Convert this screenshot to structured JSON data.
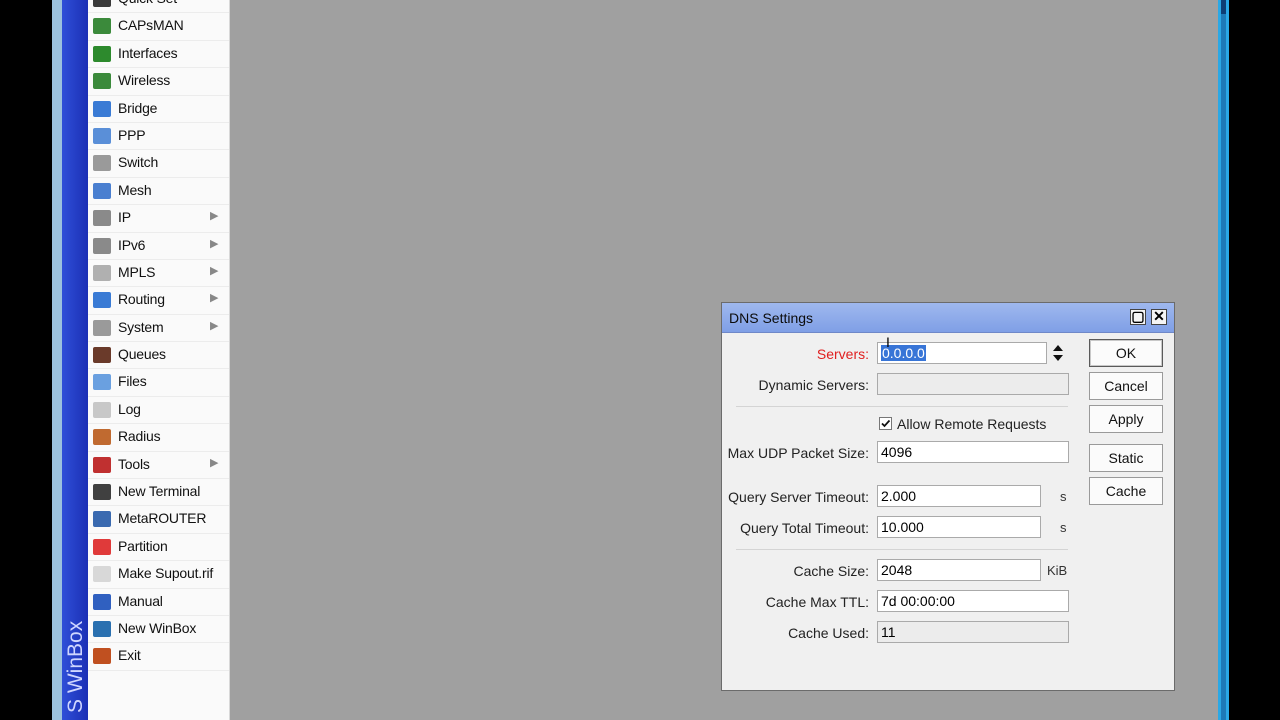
{
  "sidebar": {
    "brand": "S WinBox",
    "items": [
      {
        "label": "Quick Set",
        "icon": "quick-set-icon",
        "color": "#3a3a3a",
        "submenu": false
      },
      {
        "label": "CAPsMAN",
        "icon": "antenna-icon",
        "color": "#3b8a3b",
        "submenu": false
      },
      {
        "label": "Interfaces",
        "icon": "interfaces-icon",
        "color": "#2d8a2d",
        "submenu": false
      },
      {
        "label": "Wireless",
        "icon": "antenna-icon",
        "color": "#3b8a3b",
        "submenu": false
      },
      {
        "label": "Bridge",
        "icon": "bridge-icon",
        "color": "#3a7bd5",
        "submenu": false
      },
      {
        "label": "PPP",
        "icon": "ppp-icon",
        "color": "#5a8fd8",
        "submenu": false
      },
      {
        "label": "Switch",
        "icon": "switch-icon",
        "color": "#9a9a9a",
        "submenu": false
      },
      {
        "label": "Mesh",
        "icon": "mesh-icon",
        "color": "#4a7fd0",
        "submenu": false
      },
      {
        "label": "IP",
        "icon": "ip-icon",
        "color": "#8a8a8a",
        "submenu": true
      },
      {
        "label": "IPv6",
        "icon": "ipv6-icon",
        "color": "#8a8a8a",
        "submenu": true
      },
      {
        "label": "MPLS",
        "icon": "mpls-icon",
        "color": "#b0b0b0",
        "submenu": true
      },
      {
        "label": "Routing",
        "icon": "routing-icon",
        "color": "#3a7bd5",
        "submenu": true
      },
      {
        "label": "System",
        "icon": "gear-icon",
        "color": "#9a9a9a",
        "submenu": true
      },
      {
        "label": "Queues",
        "icon": "queues-icon",
        "color": "#6a3a2a",
        "submenu": false
      },
      {
        "label": "Files",
        "icon": "folder-icon",
        "color": "#6aa0e0",
        "submenu": false
      },
      {
        "label": "Log",
        "icon": "log-icon",
        "color": "#c8c8c8",
        "submenu": false
      },
      {
        "label": "Radius",
        "icon": "radius-icon",
        "color": "#c06a30",
        "submenu": false
      },
      {
        "label": "Tools",
        "icon": "tools-icon",
        "color": "#c03030",
        "submenu": true
      },
      {
        "label": "New Terminal",
        "icon": "terminal-icon",
        "color": "#404040",
        "submenu": false
      },
      {
        "label": "MetaROUTER",
        "icon": "metarouter-icon",
        "color": "#3a6ab0",
        "submenu": false
      },
      {
        "label": "Partition",
        "icon": "partition-icon",
        "color": "#e03a3a",
        "submenu": false
      },
      {
        "label": "Make Supout.rif",
        "icon": "document-icon",
        "color": "#d8d8d8",
        "submenu": false
      },
      {
        "label": "Manual",
        "icon": "help-icon",
        "color": "#3060c0",
        "submenu": false
      },
      {
        "label": "New WinBox",
        "icon": "globe-icon",
        "color": "#2a70b0",
        "submenu": false
      },
      {
        "label": "Exit",
        "icon": "exit-icon",
        "color": "#c05020",
        "submenu": false
      }
    ]
  },
  "dialog": {
    "title": "DNS Settings",
    "servers_label": "Servers:",
    "servers_value": "0.0.0.0",
    "dynamic_servers_label": "Dynamic Servers:",
    "dynamic_servers_value": "",
    "allow_remote_label": "Allow Remote Requests",
    "allow_remote_checked": true,
    "max_udp_label": "Max UDP Packet Size:",
    "max_udp_value": "4096",
    "query_server_timeout_label": "Query Server Timeout:",
    "query_server_timeout_value": "2.000",
    "query_total_timeout_label": "Query Total Timeout:",
    "query_total_timeout_value": "10.000",
    "seconds_unit": "s",
    "cache_size_label": "Cache Size:",
    "cache_size_value": "2048",
    "cache_size_unit": "KiB",
    "cache_max_ttl_label": "Cache Max TTL:",
    "cache_max_ttl_value": "7d 00:00:00",
    "cache_used_label": "Cache Used:",
    "cache_used_value": "11",
    "buttons": {
      "ok": "OK",
      "cancel": "Cancel",
      "apply": "Apply",
      "static": "Static",
      "cache": "Cache"
    }
  }
}
